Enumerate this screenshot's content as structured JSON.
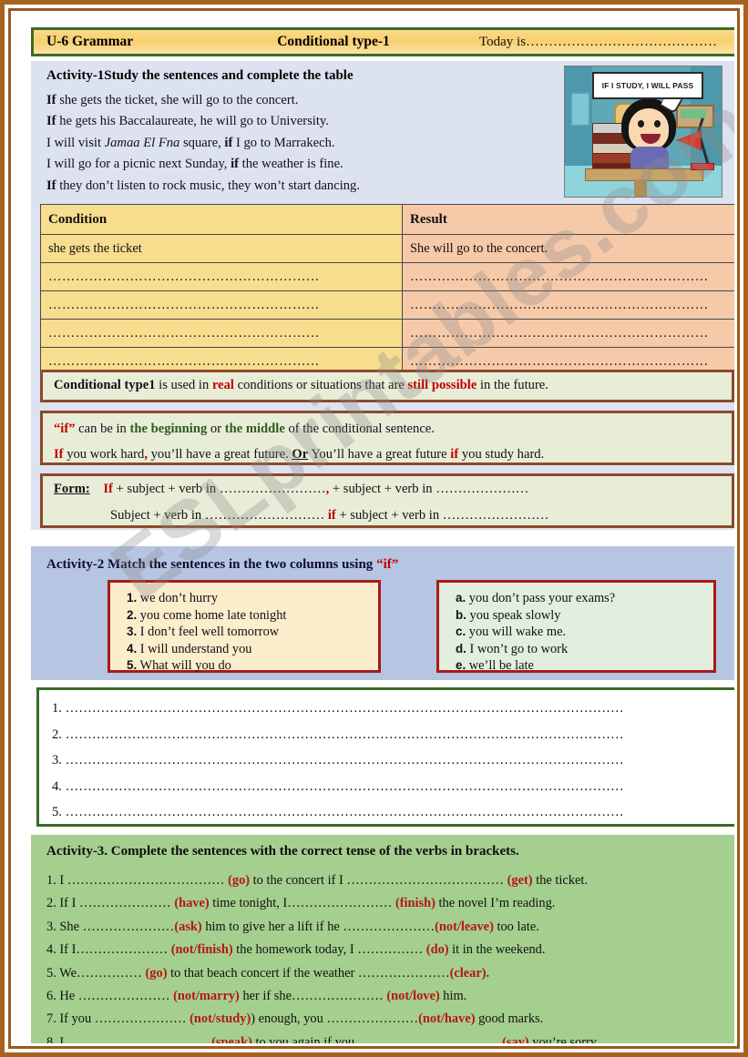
{
  "header": {
    "unit": "U-6 Grammar",
    "topic": "Conditional type-1",
    "date_label": "Today is……………………………………"
  },
  "activity1": {
    "title": "Activity-1Study the sentences and complete the table",
    "sentences": [
      {
        "bold_pre": "If",
        "text": " she gets the ticket, she will go to the concert."
      },
      {
        "bold_pre": "If",
        "text": " he gets his Baccalaureate, he will go to University."
      },
      {
        "plain1": "I will visit ",
        "italic": "Jamaa El Fna",
        "plain2": " square, ",
        "bold": "if",
        "plain3": " I go to Marrakech."
      },
      {
        "plain1": "I will go for a picnic next Sunday, ",
        "bold": "if",
        "plain3": " the weather is fine."
      },
      {
        "bold_pre": "If",
        "text": " they don’t listen to rock music, they won’t start dancing."
      }
    ],
    "picture": {
      "alt": "cartoon girl studying at desk with books and lamp",
      "bubble_text": "IF I STUDY, I WILL PASS"
    }
  },
  "table": {
    "headers": [
      "Condition",
      "Result"
    ],
    "rows": [
      [
        "she gets the ticket",
        "She will go to the concert."
      ],
      [
        "……………………………………………………",
        "…………………………………………………………"
      ],
      [
        "……………………………………………………",
        "…………………………………………………………"
      ],
      [
        "……………………………………………………",
        "…………………………………………………………"
      ],
      [
        "……………………………………………………",
        "…………………………………………………………"
      ]
    ]
  },
  "rules": {
    "rule1": {
      "bold": "Conditional type1",
      "t1": " is used in ",
      "red1": "real",
      "t2": " conditions or situations that are ",
      "red2": "still possible",
      "t3": " in the future."
    },
    "rule2": {
      "line1": {
        "red1": "“if”",
        "t1": " can be in ",
        "green1": "the beginning",
        "t2": " or ",
        "green2": "the middle",
        "t3": " of the conditional sentence."
      },
      "line2": {
        "red1": "If",
        "t1": " you work hard",
        "red2": ",",
        "t2": " you’ll have a great future.   ",
        "or": "Or",
        "t3": "    You’ll have a great future ",
        "red3": "if",
        "t4": " you study hard."
      }
    },
    "form": {
      "label": "Form:",
      "line1": {
        "red1": "If",
        "t1": " + subject + verb in ……………………",
        "red2": ",",
        "t2": " + subject + verb in …………………"
      },
      "line2": {
        "t1": "Subject + verb in ……………………… ",
        "red1": "if",
        "t2": " + subject + verb in ……………………"
      }
    }
  },
  "activity2": {
    "title_plain": "Activity-2 Match the sentences in the two columns using ",
    "title_red": "“if”",
    "left_column": [
      {
        "num": "1.",
        "text": " we don’t hurry"
      },
      {
        "num": "2.",
        "text": " you come home late tonight"
      },
      {
        "num": "3.",
        "text": " I don’t feel well tomorrow"
      },
      {
        "num": "4.",
        "text": " I will understand you"
      },
      {
        "num": "5.",
        "text": " What will you do"
      }
    ],
    "right_column": [
      {
        "num": "a.",
        "text": " you don’t pass your exams?"
      },
      {
        "num": "b.",
        "text": " you speak slowly"
      },
      {
        "num": "c.",
        "text": " you will wake me."
      },
      {
        "num": "d.",
        "text": " I won’t go to work"
      },
      {
        "num": "e.",
        "text": " we’ll be late"
      }
    ],
    "answer_lines": [
      "1. ………………………………………………………………………………………………………………",
      "2. ………………………………………………………………………………………………………………",
      "3. ………………………………………………………………………………………………………………",
      "4. ………………………………………………………………………………………………………………",
      "5. ………………………………………………………………………………………………………………"
    ]
  },
  "activity3": {
    "title": "Activity-3. Complete the sentences with the correct tense of the verbs in brackets.",
    "items": [
      {
        "num": "1.",
        "p1": " I ……………………………… ",
        "v1": "(go)",
        "p2": " to the concert if I ……………………………… ",
        "v2": "(get)",
        "p3": " the ticket."
      },
      {
        "num": "2.",
        "p1": " If I ………………… ",
        "v1": "(have)",
        "p2": " time tonight, I…………………… ",
        "v2": "(finish)",
        "p3": " the novel I’m reading."
      },
      {
        "num": "3.",
        "p1": " She …………………",
        "v1": "(ask)",
        "p2": " him to give her a lift if he …………………",
        "v2": "(not/leave)",
        "p3": " too late."
      },
      {
        "num": "4.",
        "p1": " If I………………… ",
        "v1": "(not/finish)",
        "p2": " the homework today, I …………… ",
        "v2": "(do)",
        "p3": " it in the weekend."
      },
      {
        "num": "5.",
        "p1": " We…………… ",
        "v1": "(go)",
        "p2": " to that beach concert if the weather …………………",
        "v2": "(clear).",
        "p3": ""
      },
      {
        "num": "6.",
        "p1": " He ………………… ",
        "v1": "(not/marry)",
        "p2": " her if she………………… ",
        "v2": "(not/love)",
        "p3": " him."
      },
      {
        "num": "7.",
        "p1": " If you ………………… ",
        "v1": "(not/study)",
        "p2": ") enough, you …………………",
        "v2": "(not/have)",
        "p3": " good marks."
      },
      {
        "num": "8.",
        "p1": " I ……………………………",
        "v1": "(speak)",
        "p2": " to you again if you…………………………… ",
        "v2": "(say)",
        "p3": " you’re sorry."
      }
    ]
  },
  "watermark": "ESLprintables.com",
  "colors": {
    "page_border": "#a9611f",
    "header_fill": "#f9cf6f",
    "header_border": "#3d6b22",
    "band1": "#dde2f0",
    "band2": "#b6c5e2",
    "band3": "#a4cf8e",
    "table_condition": "#f7dd8e",
    "table_result": "#f6c9a8",
    "rule_fill": "#e8edd8",
    "rule_border": "#8b4a2b",
    "match_border": "#a71b18",
    "accent_red": "#c00000",
    "accent_green": "#2f5d1e"
  }
}
